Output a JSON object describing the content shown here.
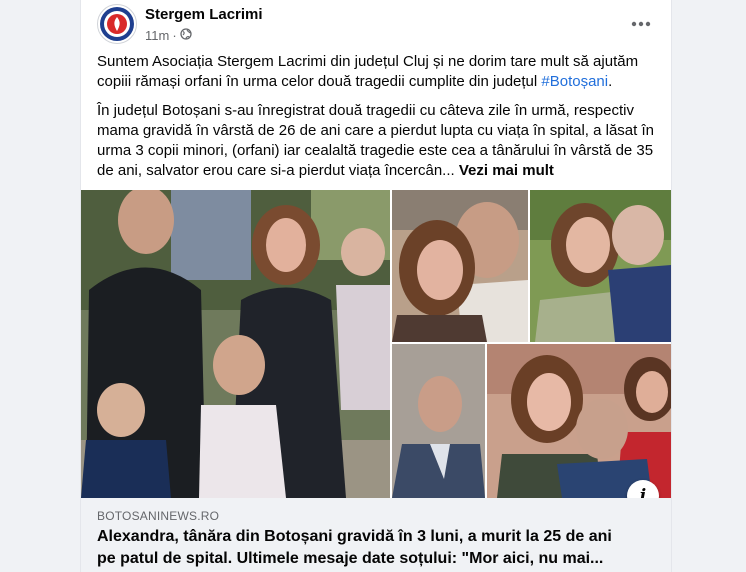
{
  "post": {
    "page_name": "Stergem Lacrimi",
    "time": "11m",
    "privacy_icon": "globe-icon",
    "paragraph1_text": "Suntem Asociația Stergem Lacrimi din județul Cluj și ne dorim tare mult să ajutăm copiii rămași orfani în urma celor două tragedii cumplite din județul ",
    "hashtag": "#Botoșani",
    "paragraph1_end": ".",
    "paragraph2_text": "În județul Botoșani s-au înregistrat două tragedii cu câteva zile în urmă, respectiv mama gravidă în vârstă de 26 de ani care a pierdut lupta cu viața în spital, a lăsat în urma 3 copii minori, (orfani) iar cealaltă tragedie este cea a tânărului în vârstă de 35 de ani, salvator erou care si-a pierdut viața încercân... ",
    "see_more": "Vezi mai mult"
  },
  "link_preview": {
    "domain": "BOTOSANINEWS.RO",
    "title": "Alexandra, tânăra din Botoșani gravidă în 3 luni, a murit la 25 de ani pe patul de spital. Ultimele mesaje date soțului: \"Mor aici, nu mai..."
  },
  "info_label": "i",
  "colors": {
    "link": "#216fdb",
    "secondary_text": "#65676b",
    "preview_bg": "#f0f2f5"
  }
}
